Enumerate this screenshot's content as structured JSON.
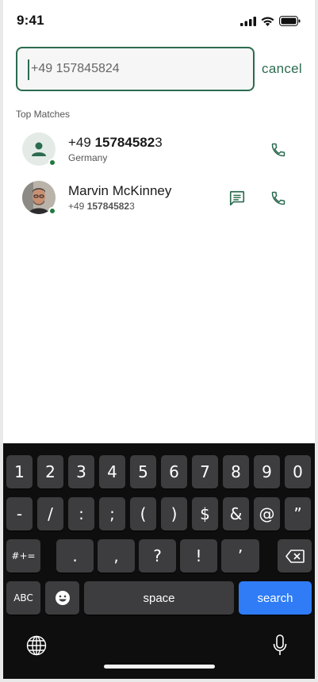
{
  "status_bar": {
    "time": "9:41"
  },
  "search": {
    "value": "+49 157845824",
    "cancel_label": "cancel"
  },
  "section": {
    "title": "Top Matches"
  },
  "matches": [
    {
      "name_prefix": "+49 ",
      "name_bold": "15784582",
      "name_suffix": "3",
      "sub_prefix": "Germany",
      "sub_bold": "",
      "sub_suffix": "",
      "status": "online"
    },
    {
      "name_prefix": "Marvin McKinney",
      "name_bold": "",
      "name_suffix": "",
      "sub_prefix": "+49 ",
      "sub_bold": "15784582",
      "sub_suffix": "3",
      "status": "online"
    }
  ],
  "keyboard": {
    "row1": [
      "1",
      "2",
      "3",
      "4",
      "5",
      "6",
      "7",
      "8",
      "9",
      "0"
    ],
    "row2": [
      "-",
      "/",
      ":",
      ";",
      "(",
      ")",
      "$",
      "&",
      "@",
      "”"
    ],
    "row3": {
      "mode": "#+=",
      "keys": [
        ".",
        ",",
        "?",
        "!",
        "’"
      ]
    },
    "row4": {
      "abc": "ABC",
      "space": "space",
      "search": "search"
    }
  },
  "colors": {
    "accent": "#2b6b4f",
    "online": "#1f7a3e",
    "search_key": "#2f7cf6",
    "keyboard_bg": "#0e0e0e",
    "key": "#3d3d3f"
  }
}
